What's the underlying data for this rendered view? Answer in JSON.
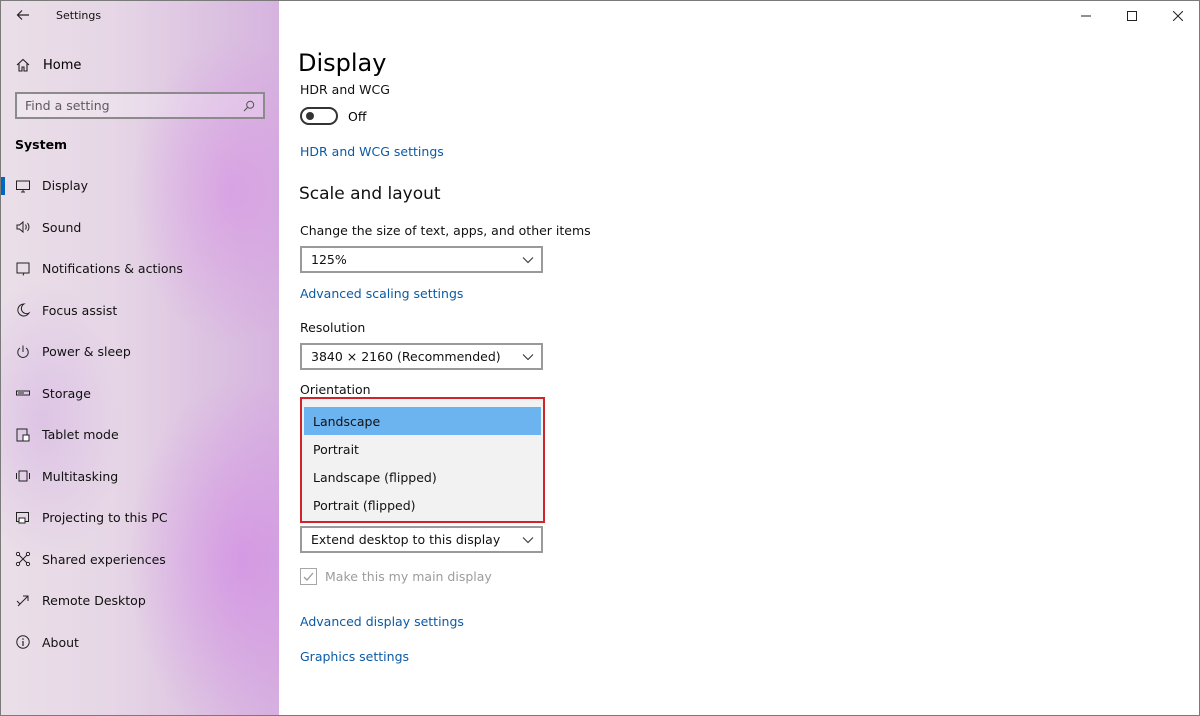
{
  "window": {
    "app_title": "Settings"
  },
  "sidebar": {
    "home_label": "Home",
    "search": {
      "placeholder": "Find a setting"
    },
    "section_title": "System",
    "items": [
      {
        "label": "Display",
        "icon": "monitor-icon",
        "active": true
      },
      {
        "label": "Sound",
        "icon": "speaker-icon"
      },
      {
        "label": "Notifications & actions",
        "icon": "notification-icon"
      },
      {
        "label": "Focus assist",
        "icon": "moon-icon"
      },
      {
        "label": "Power & sleep",
        "icon": "power-icon"
      },
      {
        "label": "Storage",
        "icon": "storage-icon"
      },
      {
        "label": "Tablet mode",
        "icon": "tablet-icon"
      },
      {
        "label": "Multitasking",
        "icon": "multitasking-icon"
      },
      {
        "label": "Projecting to this PC",
        "icon": "projecting-icon"
      },
      {
        "label": "Shared experiences",
        "icon": "shared-icon"
      },
      {
        "label": "Remote Desktop",
        "icon": "remote-icon"
      },
      {
        "label": "About",
        "icon": "info-icon"
      }
    ]
  },
  "main": {
    "title": "Display",
    "hdr": {
      "label": "HDR and WCG",
      "toggle_state": "Off",
      "link": "HDR and WCG settings"
    },
    "scale_layout": {
      "heading": "Scale and layout",
      "size_label": "Change the size of text, apps, and other items",
      "size_value": "125%",
      "advanced_link": "Advanced scaling settings",
      "resolution_label": "Resolution",
      "resolution_value": "3840 × 2160 (Recommended)",
      "orientation_label": "Orientation",
      "orientation_options": [
        "Landscape",
        "Portrait",
        "Landscape (flipped)",
        "Portrait (flipped)"
      ],
      "orientation_selected": "Landscape"
    },
    "multiple_displays": {
      "value": "Extend desktop to this display",
      "main_display_label": "Make this my main display"
    },
    "links": {
      "advanced_display": "Advanced display settings",
      "graphics": "Graphics settings"
    }
  },
  "colors": {
    "accent": "#0067c0",
    "link": "#0b5aa5",
    "highlight_border": "#d2232a",
    "selected_option": "#6cb4ef"
  }
}
